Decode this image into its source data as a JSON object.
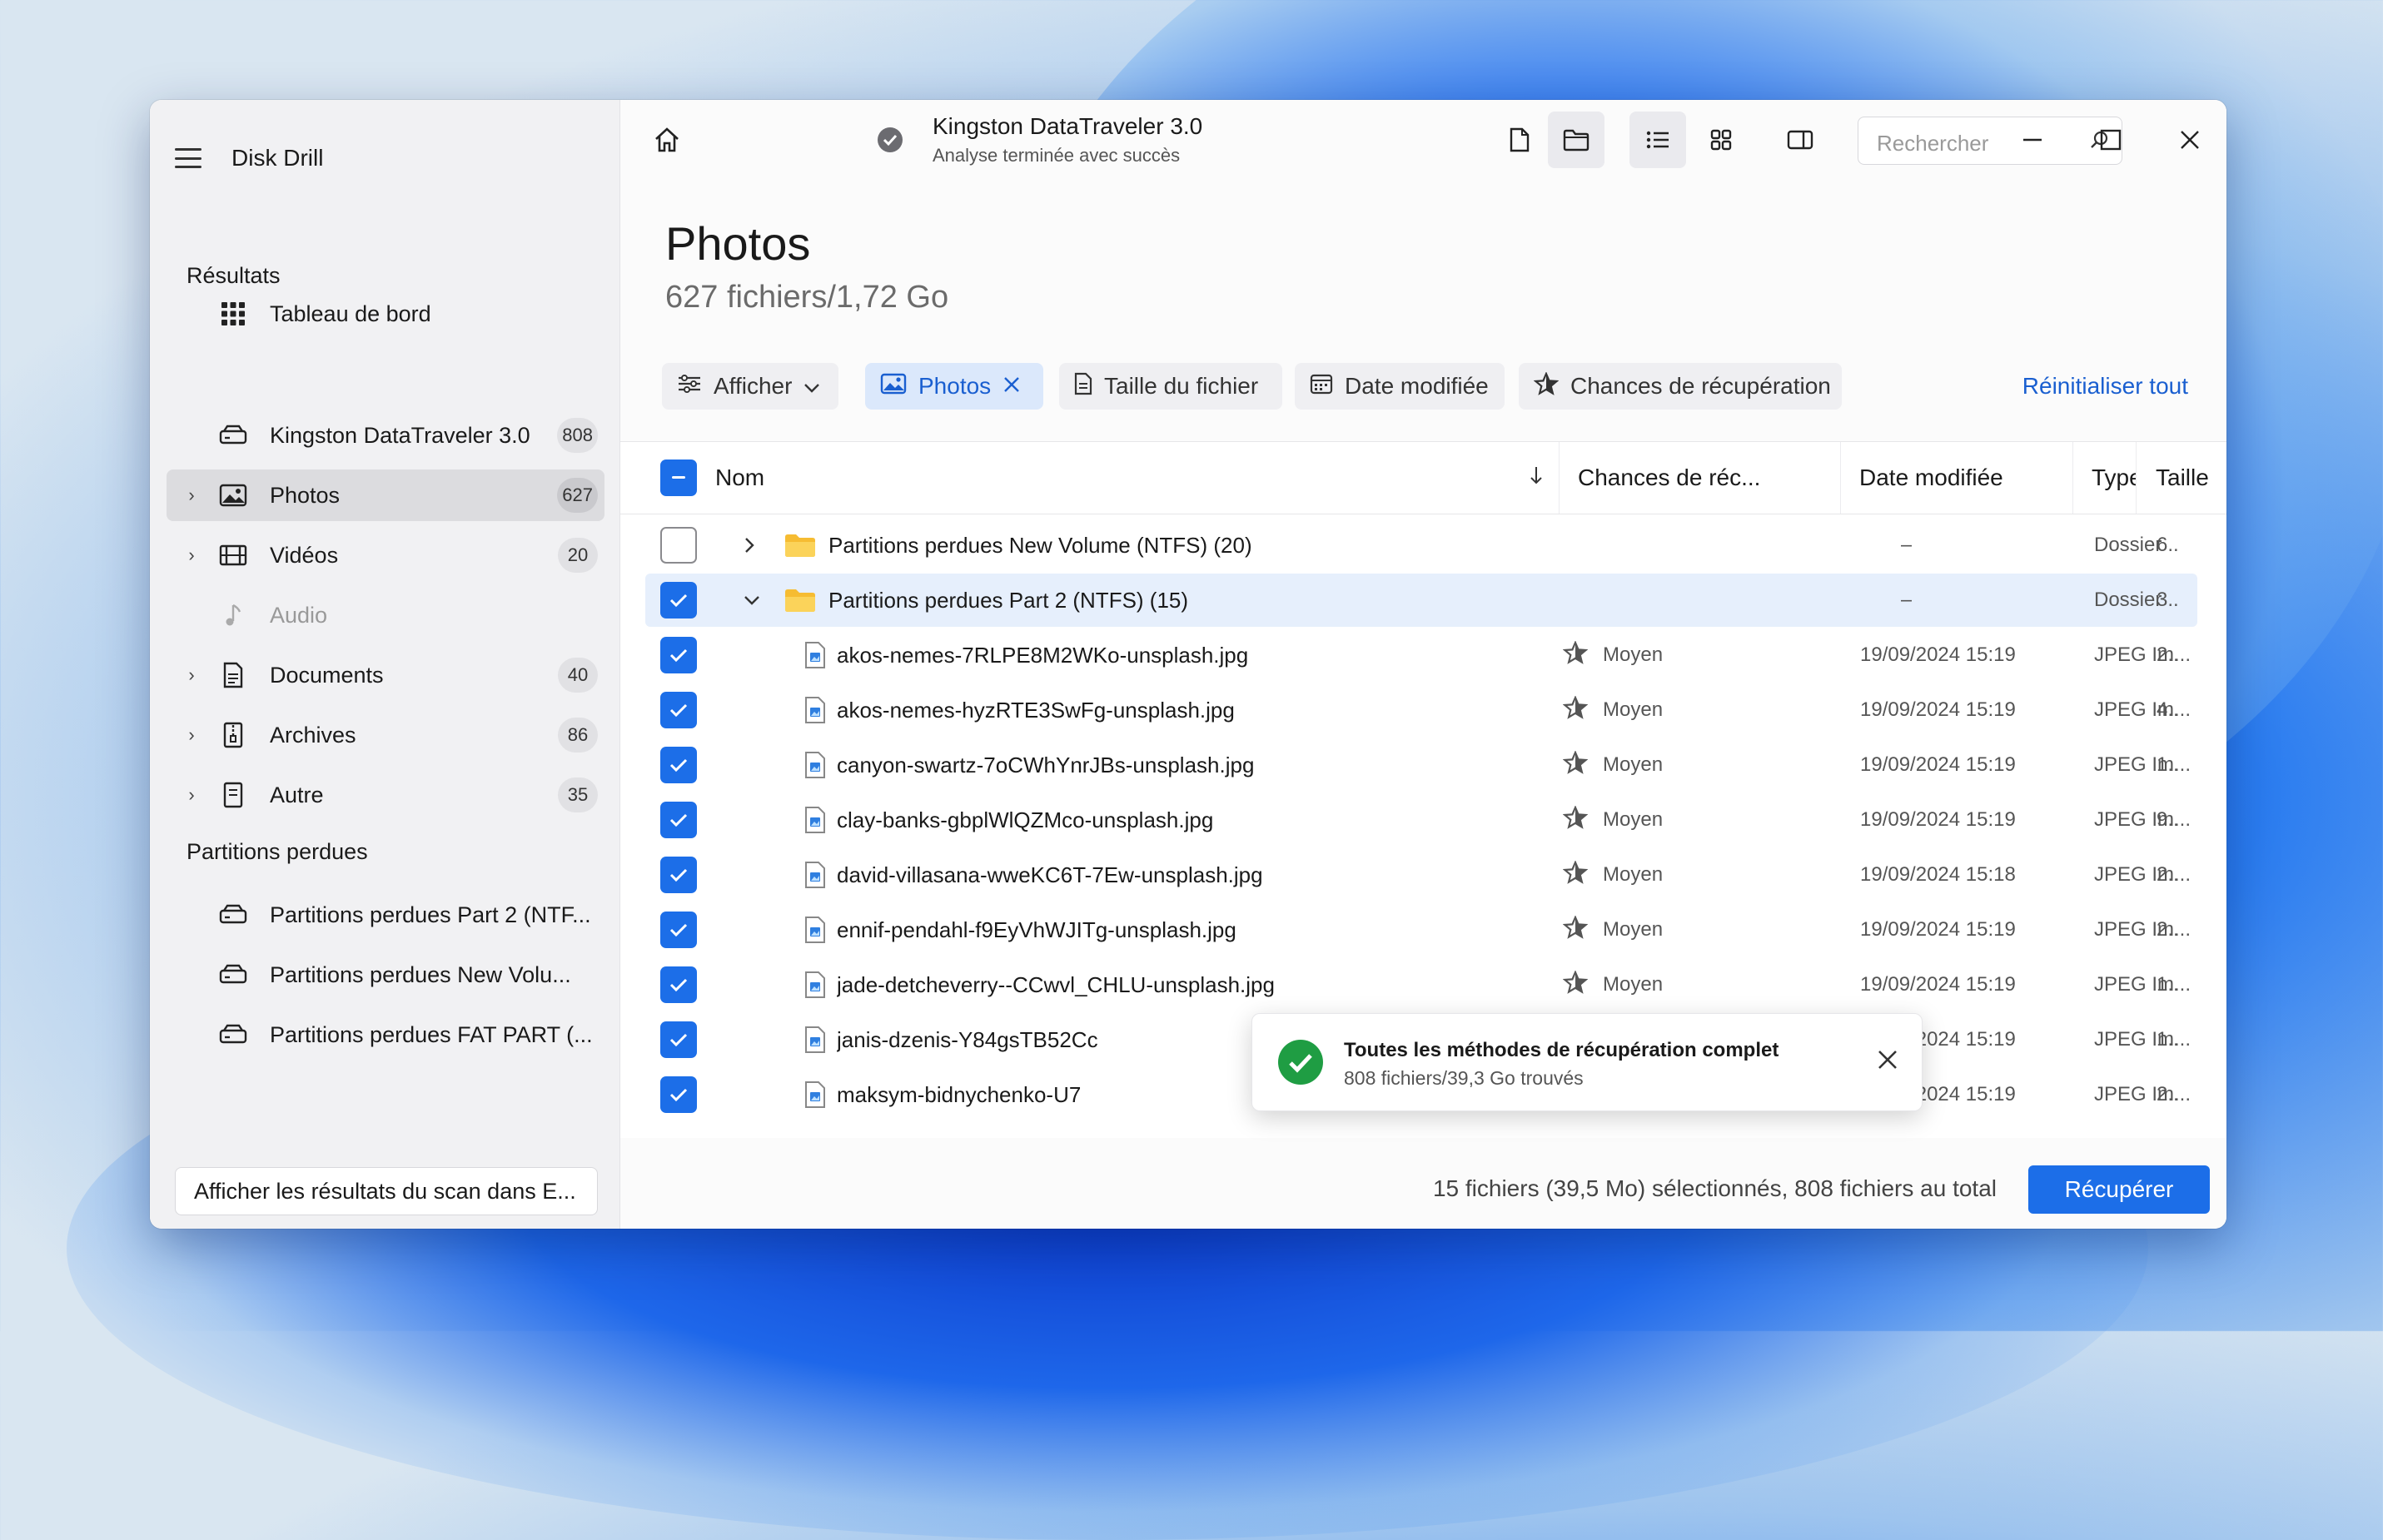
{
  "app": {
    "title": "Disk Drill"
  },
  "sidebar": {
    "dashboard_label": "Tableau de bord",
    "results_section": "Résultats",
    "results": [
      {
        "label": "Kingston DataTraveler 3.0",
        "count": "808",
        "icon": "drive-icon"
      },
      {
        "label": "Photos",
        "count": "627",
        "icon": "image-icon",
        "selected": true
      },
      {
        "label": "Vidéos",
        "count": "20",
        "icon": "film-icon"
      },
      {
        "label": "Audio",
        "count": "",
        "icon": "music-note-icon",
        "disabled": true
      },
      {
        "label": "Documents",
        "count": "40",
        "icon": "document-icon"
      },
      {
        "label": "Archives",
        "count": "86",
        "icon": "archive-icon"
      },
      {
        "label": "Autre",
        "count": "35",
        "icon": "file-icon"
      }
    ],
    "lost_section": "Partitions perdues",
    "lost_partitions": [
      {
        "label": "Partitions perdues Part 2 (NTF..."
      },
      {
        "label": "Partitions perdues New Volu..."
      },
      {
        "label": "Partitions perdues FAT PART (..."
      }
    ],
    "footer_button": "Afficher les résultats du scan dans E..."
  },
  "header": {
    "device_name": "Kingston DataTraveler 3.0",
    "device_status": "Analyse terminée avec succès",
    "search_placeholder": "Rechercher"
  },
  "page": {
    "title": "Photos",
    "subtitle": "627 fichiers/1,72 Go"
  },
  "filters": {
    "show_label": "Afficher",
    "photos_chip": "Photos",
    "size_chip": "Taille du fichier",
    "date_chip": "Date modifiée",
    "chances_chip": "Chances de récupération",
    "reset_all": "Réinitialiser tout"
  },
  "table": {
    "columns": {
      "name": "Nom",
      "chances": "Chances de réc...",
      "date": "Date modifiée",
      "type": "Type",
      "size": "Taille"
    },
    "rows": [
      {
        "kind": "folder",
        "checked": false,
        "expanded": false,
        "name": "Partitions perdues New Volume (NTFS) (20)",
        "chances": "",
        "date": "–",
        "type": "Dossier",
        "size": "6.."
      },
      {
        "kind": "folder",
        "checked": true,
        "expanded": true,
        "name": "Partitions perdues Part 2 (NTFS) (15)",
        "chances": "",
        "date": "–",
        "type": "Dossier",
        "size": "3.."
      },
      {
        "kind": "file",
        "checked": true,
        "name": "akos-nemes-7RLPE8M2WKo-unsplash.jpg",
        "chances": "Moyen",
        "date": "19/09/2024 15:19",
        "type": "JPEG Im...",
        "size": "2.."
      },
      {
        "kind": "file",
        "checked": true,
        "name": "akos-nemes-hyzRTE3SwFg-unsplash.jpg",
        "chances": "Moyen",
        "date": "19/09/2024 15:19",
        "type": "JPEG Im...",
        "size": "4.."
      },
      {
        "kind": "file",
        "checked": true,
        "name": "canyon-swartz-7oCWhYnrJBs-unsplash.jpg",
        "chances": "Moyen",
        "date": "19/09/2024 15:19",
        "type": "JPEG Im...",
        "size": "1.."
      },
      {
        "kind": "file",
        "checked": true,
        "name": "clay-banks-gbplWlQZMco-unsplash.jpg",
        "chances": "Moyen",
        "date": "19/09/2024 15:19",
        "type": "JPEG Im...",
        "size": "9.."
      },
      {
        "kind": "file",
        "checked": true,
        "name": "david-villasana-wweKC6T-7Ew-unsplash.jpg",
        "chances": "Moyen",
        "date": "19/09/2024 15:18",
        "type": "JPEG Im...",
        "size": "2.."
      },
      {
        "kind": "file",
        "checked": true,
        "name": "ennif-pendahl-f9EyVhWJITg-unsplash.jpg",
        "chances": "Moyen",
        "date": "19/09/2024 15:19",
        "type": "JPEG Im...",
        "size": "2.."
      },
      {
        "kind": "file",
        "checked": true,
        "name": "jade-detcheverry--CCwvl_CHLU-unsplash.jpg",
        "chances": "Moyen",
        "date": "19/09/2024 15:19",
        "type": "JPEG Im...",
        "size": "1.."
      },
      {
        "kind": "file",
        "checked": true,
        "name": "janis-dzenis-Y84gsTB52Cc",
        "chances": "",
        "date": "19/09/2024 15:19",
        "type": "JPEG Im...",
        "size": "1.."
      },
      {
        "kind": "file",
        "checked": true,
        "name": "maksym-bidnychenko-U7",
        "chances": "",
        "date": "19/09/2024 15:19",
        "type": "JPEG Im...",
        "size": "2.."
      }
    ]
  },
  "toast": {
    "title": "Toutes les méthodes de récupération complet",
    "subtitle": "808 fichiers/39,3 Go trouvés"
  },
  "footer": {
    "status": "15 fichiers (39,5 Mo) sélectionnés, 808 fichiers au total",
    "recover_button": "Récupérer"
  },
  "colors": {
    "accent": "#1c6ee8",
    "selected_row": "#e6effc"
  }
}
